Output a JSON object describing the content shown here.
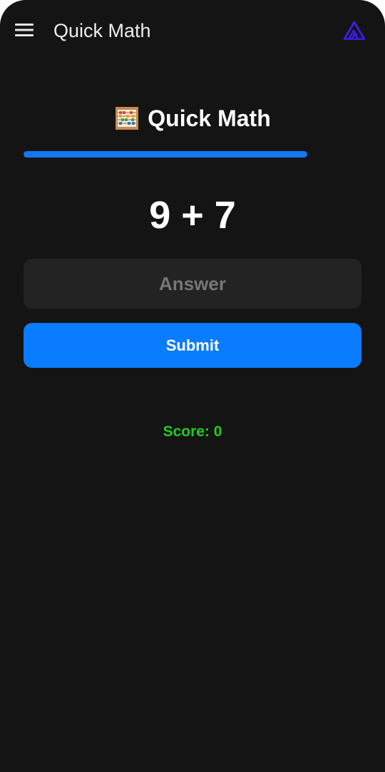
{
  "app_bar": {
    "title": "Quick Math",
    "menu_icon": "hamburger-menu-icon",
    "logo_icon": "brand-triangle-logo-icon"
  },
  "game": {
    "heading_icon": "abacus-icon",
    "heading": "Quick Math",
    "progress": 0.84,
    "problem": "9 + 7",
    "answer_placeholder": "Answer",
    "answer_value": "",
    "submit_label": "Submit",
    "score_text": "Score: 0"
  },
  "colors": {
    "background": "#141414",
    "accent": "#0a7cff",
    "progress": "#1477f0",
    "input_background": "#232323",
    "score": "#22cc22",
    "logo": "#3a1ee0"
  }
}
